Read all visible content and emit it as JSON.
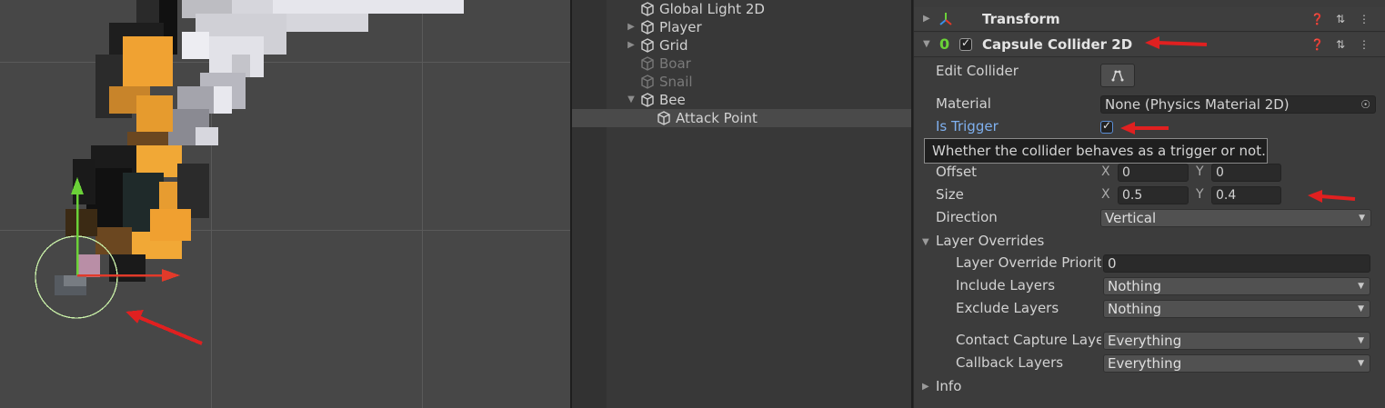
{
  "hierarchy": {
    "items": [
      {
        "label": "Global Light 2D",
        "icon": "cube-icon",
        "expanded": null,
        "enabled": true
      },
      {
        "label": "Player",
        "icon": "cube-icon",
        "expanded": false,
        "enabled": true
      },
      {
        "label": "Grid",
        "icon": "cube-icon",
        "expanded": false,
        "enabled": true
      },
      {
        "label": "Boar",
        "icon": "cube-icon",
        "expanded": null,
        "enabled": false
      },
      {
        "label": "Snail",
        "icon": "cube-icon",
        "expanded": null,
        "enabled": false
      },
      {
        "label": "Bee",
        "icon": "cube-icon",
        "expanded": true,
        "enabled": true
      },
      {
        "label": "Attack Point",
        "icon": "cube-icon",
        "expanded": null,
        "enabled": true,
        "selected": true
      }
    ]
  },
  "inspector": {
    "transform": {
      "title": "Transform"
    },
    "collider": {
      "title": "Capsule Collider 2D",
      "enabled": true,
      "edit_collider_label": "Edit Collider",
      "material_label": "Material",
      "material_value": "None (Physics Material 2D)",
      "is_trigger_label": "Is Trigger",
      "is_trigger": true,
      "tooltip": "Whether the collider behaves as a trigger or not.",
      "offset_label": "Offset",
      "offset_x": "0",
      "offset_y": "0",
      "size_label": "Size",
      "size_x": "0.5",
      "size_y": "0.4",
      "axis_x": "X",
      "axis_y": "Y",
      "direction_label": "Direction",
      "direction_value": "Vertical",
      "layer_overrides_label": "Layer Overrides",
      "layer_override_priority_label": "Layer Override Priorit",
      "layer_override_priority_value": "0",
      "include_layers_label": "Include Layers",
      "include_layers_value": "Nothing",
      "exclude_layers_label": "Exclude Layers",
      "exclude_layers_value": "Nothing",
      "contact_capture_label": "Contact Capture Laye",
      "contact_capture_value": "Everything",
      "callback_layers_label": "Callback Layers",
      "callback_layers_value": "Everything",
      "info_label": "Info"
    },
    "header_icons": [
      "help-icon",
      "preset-icon",
      "kebab-menu-icon"
    ]
  },
  "colors": {
    "annotation_arrow": "#e02020",
    "gizmo_y": "#6bd138",
    "gizmo_x": "#e23a2a",
    "collider_outline": "#c9f0a8",
    "link_label": "#7fb0ef"
  }
}
